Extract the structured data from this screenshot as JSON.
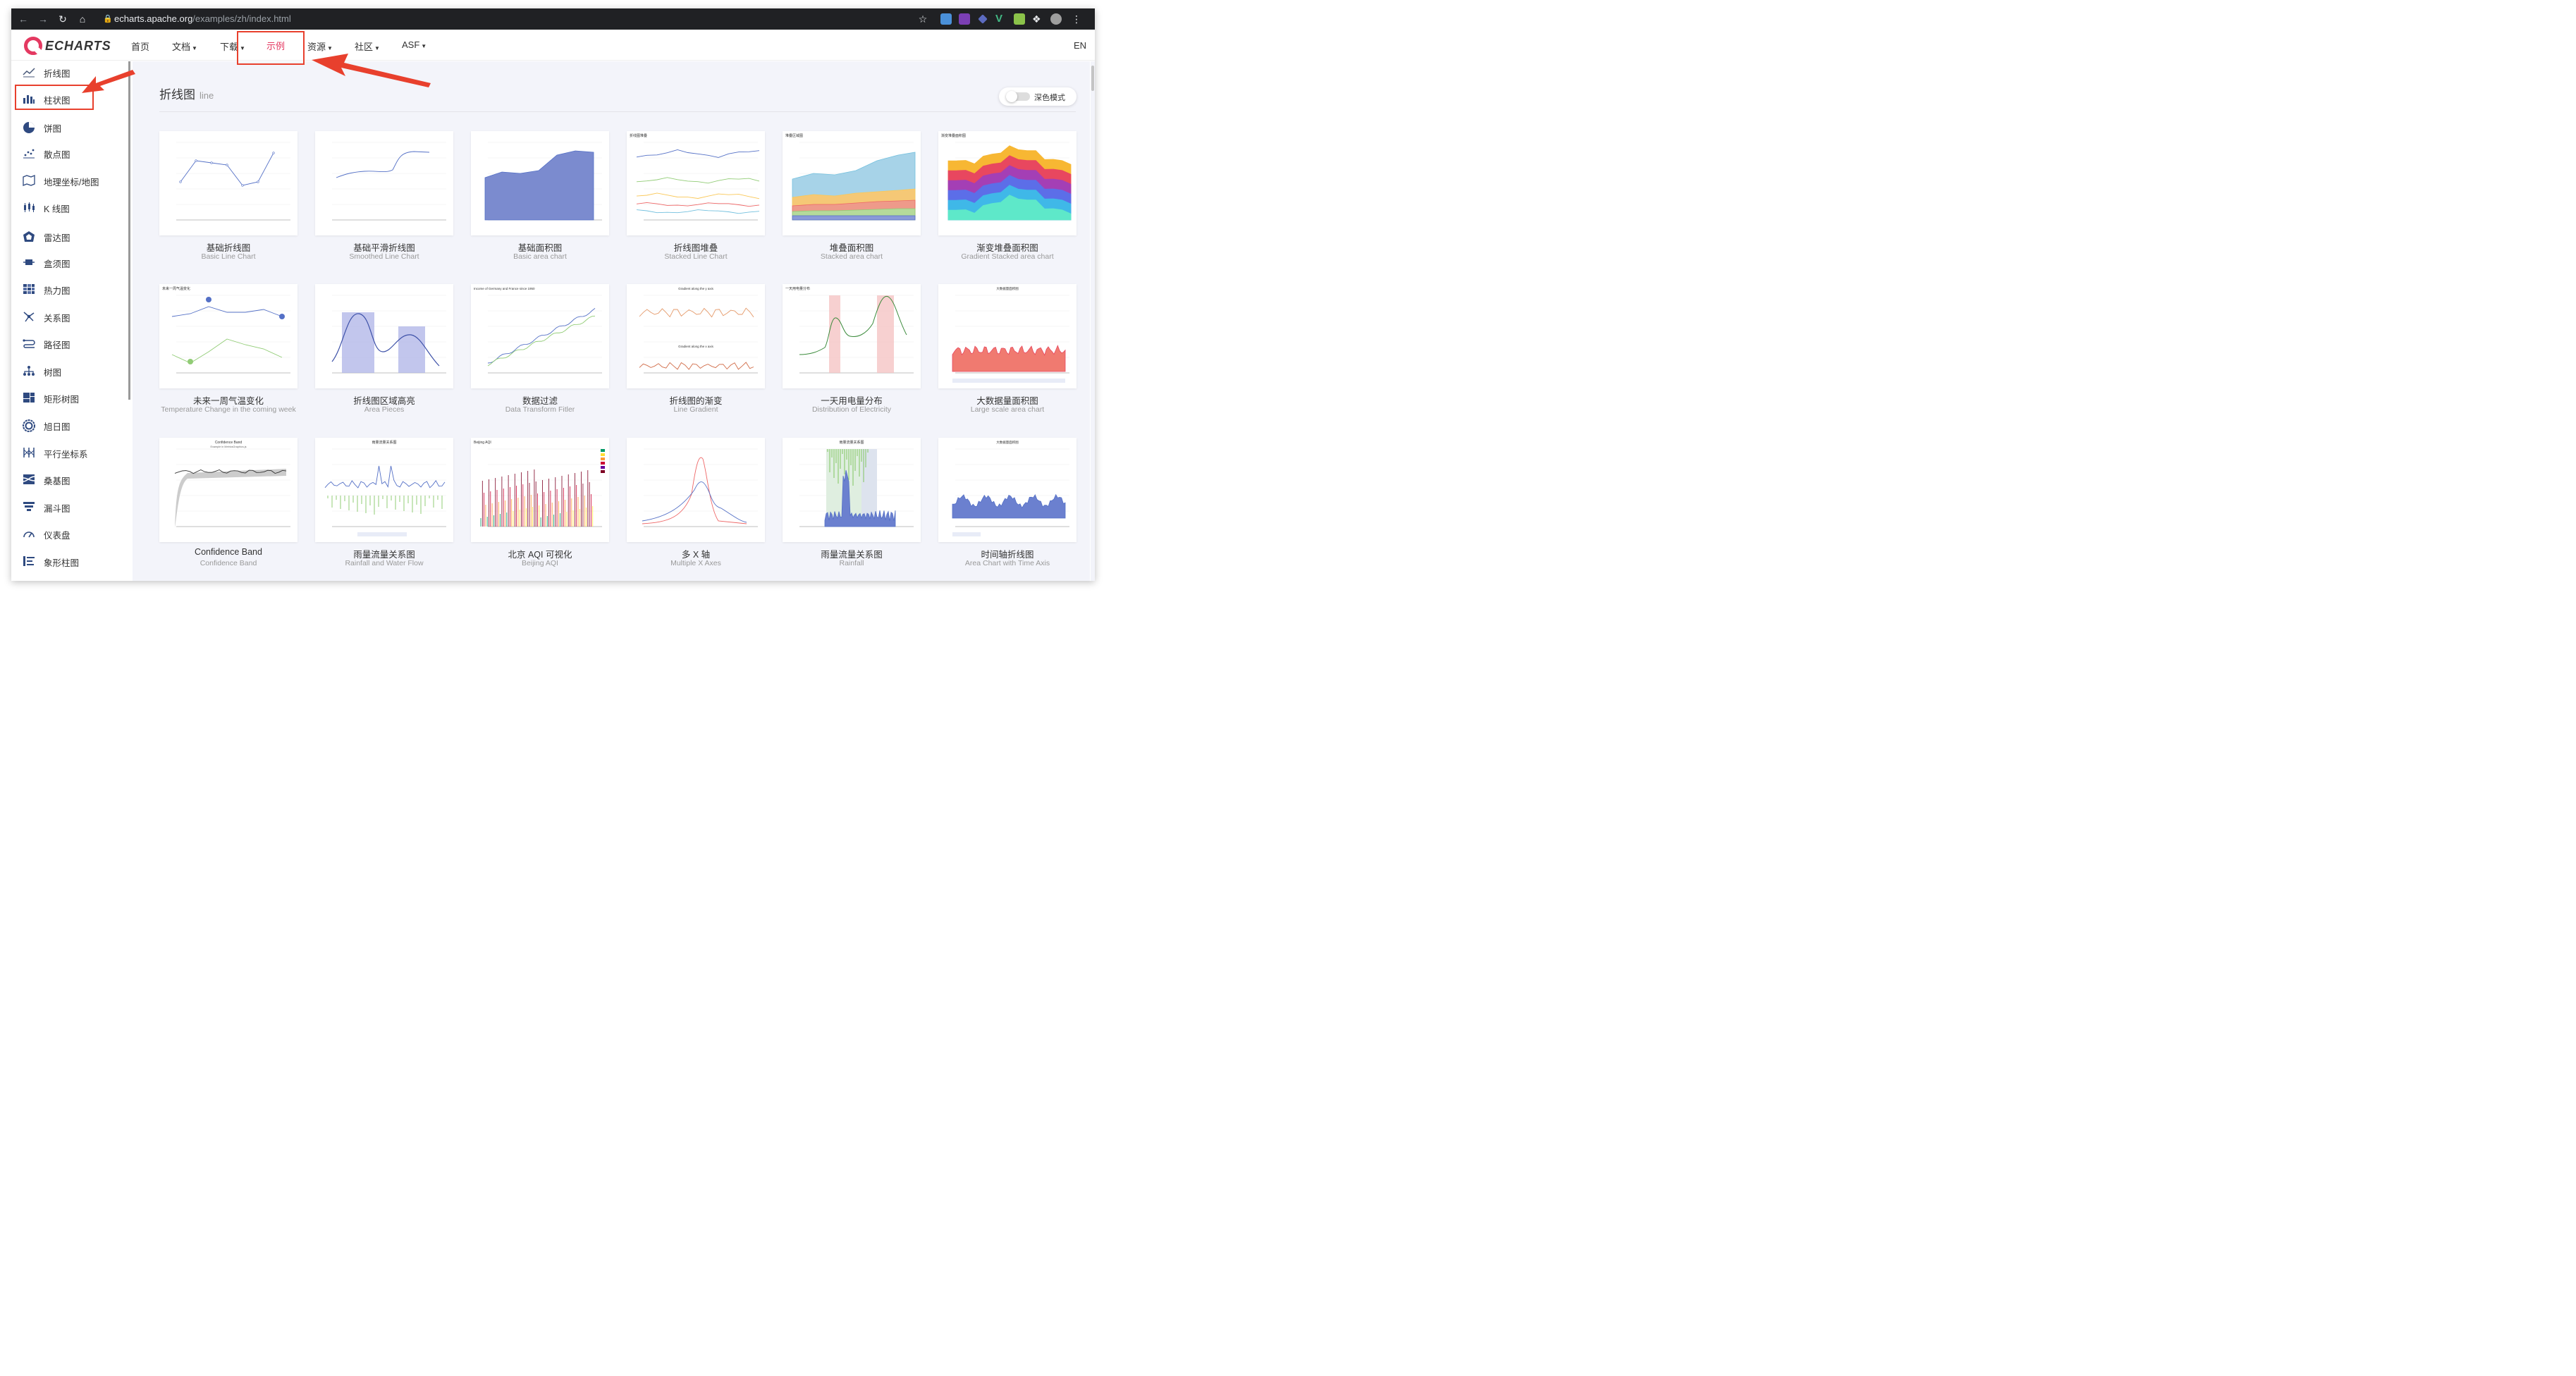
{
  "browser": {
    "url_host": "echarts.apache.org",
    "url_path": "/examples/zh/index.html"
  },
  "site": {
    "logo_text": "ECHARTS",
    "nav": [
      {
        "label": "首页",
        "dropdown": false
      },
      {
        "label": "文档",
        "dropdown": true
      },
      {
        "label": "下载",
        "dropdown": true
      },
      {
        "label": "示例",
        "dropdown": false,
        "active": true
      },
      {
        "label": "资源",
        "dropdown": true
      },
      {
        "label": "社区",
        "dropdown": true
      },
      {
        "label": "ASF",
        "dropdown": true
      }
    ],
    "lang": "EN",
    "accent_color": "#e43961"
  },
  "sidebar": {
    "items": [
      {
        "label": "折线图",
        "icon": "line-chart-icon"
      },
      {
        "label": "柱状图",
        "icon": "bar-chart-icon"
      },
      {
        "label": "饼图",
        "icon": "pie-chart-icon"
      },
      {
        "label": "散点图",
        "icon": "scatter-chart-icon"
      },
      {
        "label": "地理坐标/地图",
        "icon": "map-icon"
      },
      {
        "label": "K 线图",
        "icon": "candlestick-icon"
      },
      {
        "label": "雷达图",
        "icon": "radar-icon"
      },
      {
        "label": "盒须图",
        "icon": "boxplot-icon"
      },
      {
        "label": "热力图",
        "icon": "heatmap-icon"
      },
      {
        "label": "关系图",
        "icon": "graph-icon"
      },
      {
        "label": "路径图",
        "icon": "lines-icon"
      },
      {
        "label": "树图",
        "icon": "tree-icon"
      },
      {
        "label": "矩形树图",
        "icon": "treemap-icon"
      },
      {
        "label": "旭日图",
        "icon": "sunburst-icon"
      },
      {
        "label": "平行坐标系",
        "icon": "parallel-icon"
      },
      {
        "label": "桑基图",
        "icon": "sankey-icon"
      },
      {
        "label": "漏斗图",
        "icon": "funnel-icon"
      },
      {
        "label": "仪表盘",
        "icon": "gauge-icon"
      },
      {
        "label": "象形柱图",
        "icon": "pictorial-bar-icon"
      }
    ]
  },
  "main": {
    "title": "折线图",
    "title_sub": "line",
    "dark_mode_label": "深色模式",
    "dark_mode_on": false,
    "examples": [
      {
        "name": "基础折线图",
        "sub": "Basic Line Chart",
        "thumb": "basic-line"
      },
      {
        "name": "基础平滑折线图",
        "sub": "Smoothed Line Chart",
        "thumb": "smooth-line"
      },
      {
        "name": "基础面积图",
        "sub": "Basic area chart",
        "thumb": "basic-area"
      },
      {
        "name": "折线图堆叠",
        "sub": "Stacked Line Chart",
        "thumb": "stacked-line"
      },
      {
        "name": "堆叠面积图",
        "sub": "Stacked area chart",
        "thumb": "stacked-area"
      },
      {
        "name": "渐变堆叠面积图",
        "sub": "Gradient Stacked area chart",
        "thumb": "gradient-stacked"
      },
      {
        "name": "未来一周气温变化",
        "sub": "Temperature Change in the coming week",
        "thumb": "temperature"
      },
      {
        "name": "折线图区域高亮",
        "sub": "Area Pieces",
        "thumb": "area-pieces"
      },
      {
        "name": "数据过滤",
        "sub": "Data Transform Fitler",
        "thumb": "data-filter"
      },
      {
        "name": "折线图的渐变",
        "sub": "Line Gradient",
        "thumb": "line-gradient"
      },
      {
        "name": "一天用电量分布",
        "sub": "Distribution of Electricity",
        "thumb": "electricity"
      },
      {
        "name": "大数据量面积图",
        "sub": "Large scale area chart",
        "thumb": "large-area"
      },
      {
        "name": "Confidence Band",
        "sub": "Confidence Band",
        "thumb": "confidence"
      },
      {
        "name": "雨量流量关系图",
        "sub": "Rainfall and Water Flow",
        "thumb": "rainfall-flow"
      },
      {
        "name": "北京 AQI 可视化",
        "sub": "Beijing AQI",
        "thumb": "aqi"
      },
      {
        "name": "多 X 轴",
        "sub": "Multiple X Axes",
        "thumb": "multi-x"
      },
      {
        "name": "雨量流量关系图",
        "sub": "Rainfall",
        "thumb": "rainfall"
      },
      {
        "name": "时间轴折线图",
        "sub": "Area Chart with Time Axis",
        "thumb": "time-axis"
      }
    ]
  },
  "thumb_text": {
    "stacked_line_title": "折线图堆叠",
    "stacked_area_title": "堆叠区域图",
    "gradient_stacked_title": "渐变堆叠面积图",
    "temperature_title": "未来一周气温变化",
    "data_filter_title": "Income of Germany and France since 1950",
    "gradient_y_title": "Gradient along the y axis",
    "gradient_x_title": "Gradient along the x axis",
    "electricity_title": "一天用电量分布",
    "large_area_title": "大数据量面积图",
    "confidence_title": "Confidence Band",
    "confidence_sub": "Example in MetricsGraphics.js",
    "rainfall_title": "雨量流量关系图",
    "aqi_title": "Beijing AQI",
    "time_axis_title": "大数据量面积图"
  },
  "annotation_color": "#e8402d"
}
